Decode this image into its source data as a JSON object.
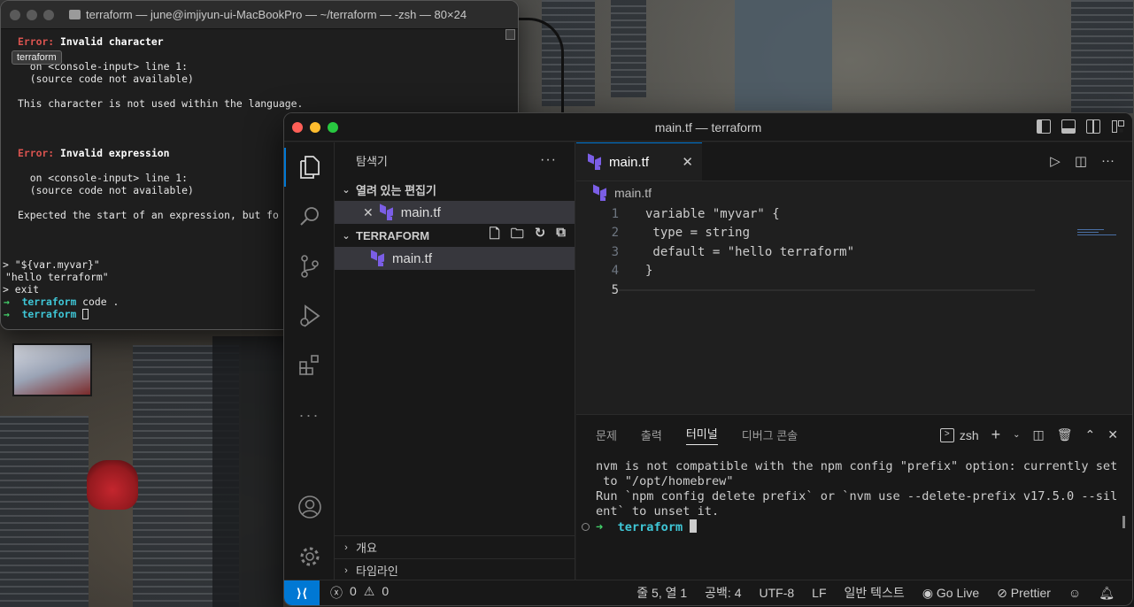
{
  "terminal": {
    "title": "terraform — june@imjiyun-ui-MacBookPro — ~/terraform — -zsh — 80×24",
    "tooltip": "terraform",
    "lines": {
      "l1_err": "Error:",
      "l1_msg": " Invalid character",
      "l3": "  on <console-input> line 1:",
      "l4": "  (source code not available)",
      "l6": "This character is not used within the language.",
      "l10_err": "Error:",
      "l10_msg": " Invalid expression",
      "l12": "  on <console-input> line 1:",
      "l13": "  (source code not available)",
      "l15": "Expected the start of an expression, but fo",
      "l20": "> \"${var.myvar}\"",
      "l21": "\"hello terraform\"",
      "l22": "> exit",
      "l23_arrow": "→",
      "l23_dir": "terraform",
      "l23_cmd": " code .",
      "l24_arrow": "→",
      "l24_dir": "terraform"
    }
  },
  "vscode": {
    "title": "main.tf — terraform",
    "explorer": {
      "header": "탐색기",
      "more": "···",
      "open_editors_label": "열려 있는 편집기",
      "open_file": "main.tf",
      "close_glyph": "✕",
      "folder_label": "TERRAFORM",
      "file": "main.tf",
      "outline_label": "개요",
      "timeline_label": "타임라인"
    },
    "tab": {
      "label": "main.tf",
      "close": "✕"
    },
    "breadcrumb": "main.tf",
    "code_lines": [
      {
        "n": "1",
        "text": "variable \"myvar\" {"
      },
      {
        "n": "2",
        "text": " type = string"
      },
      {
        "n": "3",
        "text": " default = \"hello terraform\""
      },
      {
        "n": "4",
        "text": "}"
      },
      {
        "n": "5",
        "text": ""
      }
    ],
    "panel": {
      "tabs": [
        "문제",
        "출력",
        "터미널",
        "디버그 콘솔"
      ],
      "active_tab": "터미널",
      "shell": "zsh",
      "output": [
        "nvm is not compatible with the npm config \"prefix\" option: currently set",
        " to \"/opt/homebrew\"",
        "Run `npm config delete prefix` or `nvm use --delete-prefix v17.5.0 --sil",
        "ent` to unset it."
      ],
      "prompt_arrow": "➜",
      "prompt_dir": "terraform"
    },
    "status": {
      "errors": "0",
      "warnings": "0",
      "position": "줄 5, 열 1",
      "spaces": "공백: 4",
      "encoding": "UTF-8",
      "eol": "LF",
      "language": "일반 텍스트",
      "go_live": "Go Live",
      "prettier": "Prettier"
    }
  },
  "colors": {
    "accent": "#0078d4",
    "terraform_purple": "#7b5ee6",
    "error_red": "#d9534f",
    "prompt_green": "#43d36a",
    "prompt_cyan": "#3fc6d6"
  }
}
